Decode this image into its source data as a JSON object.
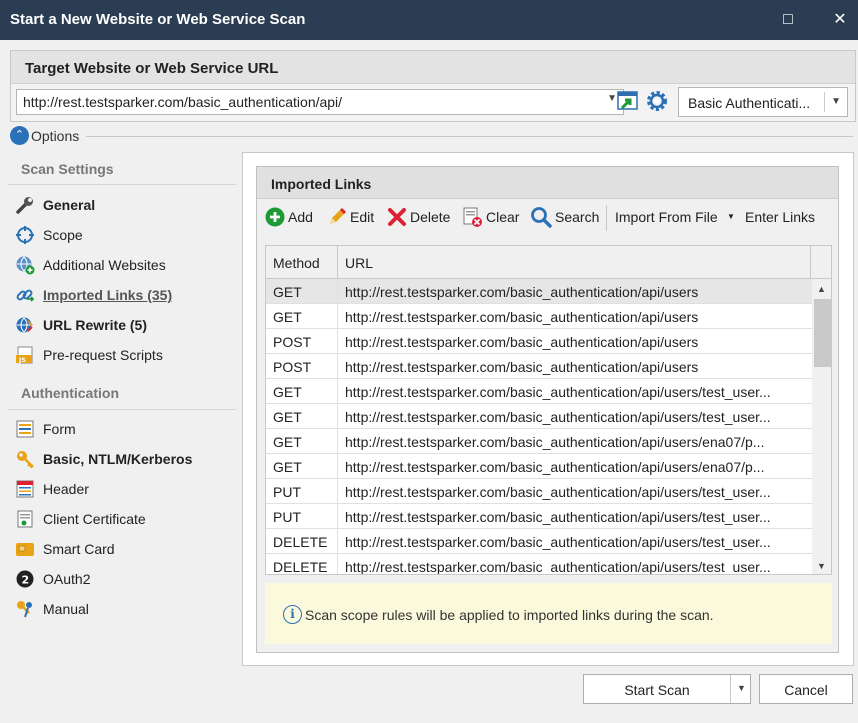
{
  "window": {
    "title": "Start a New Website or Web Service Scan",
    "maximize_glyph": "□",
    "close_glyph": "✕"
  },
  "target": {
    "header": "Target Website or Web Service URL",
    "url": "http://rest.testsparker.com/basic_authentication/api/",
    "auth_mode": "Basic Authenticati..."
  },
  "options": {
    "label": "Options"
  },
  "sidebar": {
    "scan_settings_title": "Scan Settings",
    "scan_settings": [
      {
        "label": "General",
        "icon": "wrench-icon"
      },
      {
        "label": "Scope",
        "icon": "target-icon"
      },
      {
        "label": "Additional Websites",
        "icon": "globe-add-icon"
      },
      {
        "label": "Imported Links (35)",
        "icon": "link-icon"
      },
      {
        "label": "URL Rewrite (5)",
        "icon": "url-rewrite-icon"
      },
      {
        "label": "Pre-request Scripts",
        "icon": "js-script-icon"
      }
    ],
    "authentication_title": "Authentication",
    "authentication": [
      {
        "label": "Form",
        "icon": "form-icon"
      },
      {
        "label": "Basic, NTLM/Kerberos",
        "icon": "key-icon"
      },
      {
        "label": "Header",
        "icon": "header-icon"
      },
      {
        "label": "Client Certificate",
        "icon": "certificate-icon"
      },
      {
        "label": "Smart Card",
        "icon": "smart-card-icon"
      },
      {
        "label": "OAuth2",
        "icon": "oauth2-icon"
      },
      {
        "label": "Manual",
        "icon": "manual-key-icon"
      }
    ]
  },
  "links": {
    "title": "Imported Links",
    "toolbar": {
      "add": "Add",
      "edit": "Edit",
      "delete": "Delete",
      "clear": "Clear",
      "search": "Search",
      "import": "Import From File",
      "enter": "Enter Links"
    },
    "columns": {
      "method": "Method",
      "url": "URL"
    },
    "rows": [
      {
        "method": "GET",
        "url": "http://rest.testsparker.com/basic_authentication/api/users"
      },
      {
        "method": "GET",
        "url": "http://rest.testsparker.com/basic_authentication/api/users"
      },
      {
        "method": "POST",
        "url": "http://rest.testsparker.com/basic_authentication/api/users"
      },
      {
        "method": "POST",
        "url": "http://rest.testsparker.com/basic_authentication/api/users"
      },
      {
        "method": "GET",
        "url": "http://rest.testsparker.com/basic_authentication/api/users/test_user..."
      },
      {
        "method": "GET",
        "url": "http://rest.testsparker.com/basic_authentication/api/users/test_user..."
      },
      {
        "method": "GET",
        "url": "http://rest.testsparker.com/basic_authentication/api/users/ena07/p..."
      },
      {
        "method": "GET",
        "url": "http://rest.testsparker.com/basic_authentication/api/users/ena07/p..."
      },
      {
        "method": "PUT",
        "url": "http://rest.testsparker.com/basic_authentication/api/users/test_user..."
      },
      {
        "method": "PUT",
        "url": "http://rest.testsparker.com/basic_authentication/api/users/test_user..."
      },
      {
        "method": "DELETE",
        "url": "http://rest.testsparker.com/basic_authentication/api/users/test_user..."
      },
      {
        "method": "DELETE",
        "url": "http://rest.testsparker.com/basic_authentication/api/users/test_user..."
      }
    ],
    "info": "Scan scope rules will be applied to imported links during the scan."
  },
  "footer": {
    "start_scan": "Start Scan",
    "cancel": "Cancel"
  },
  "colors": {
    "titlebar": "#2a3d52",
    "accent": "#2b71b8",
    "info_bg": "#fbf9dc"
  }
}
